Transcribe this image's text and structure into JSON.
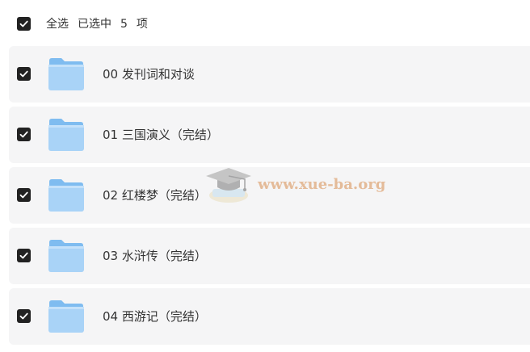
{
  "header": {
    "select_all_label": "全选",
    "selected_prefix": "已选中",
    "selected_count": "5",
    "selected_suffix": "项",
    "all_checked": true
  },
  "items": [
    {
      "name": "00 发刊词和对谈",
      "checked": true,
      "icon": "folder-icon"
    },
    {
      "name": "01 三国演义（完结）",
      "checked": true,
      "icon": "folder-icon"
    },
    {
      "name": "02 红楼梦（完结）",
      "checked": true,
      "icon": "folder-icon"
    },
    {
      "name": "03 水浒传（完结）",
      "checked": true,
      "icon": "folder-icon"
    },
    {
      "name": "04 西游记（完结）",
      "checked": true,
      "icon": "folder-icon"
    }
  ],
  "watermark": {
    "text": "www.xue-ba.org",
    "icon": "graduation-cap-icon"
  },
  "colors": {
    "row_bg": "#f5f5f6",
    "checkbox": "#222222",
    "folder_light": "#a9d3f7",
    "folder_dark": "#7fbcf0",
    "watermark_text": "#e3b58f"
  }
}
